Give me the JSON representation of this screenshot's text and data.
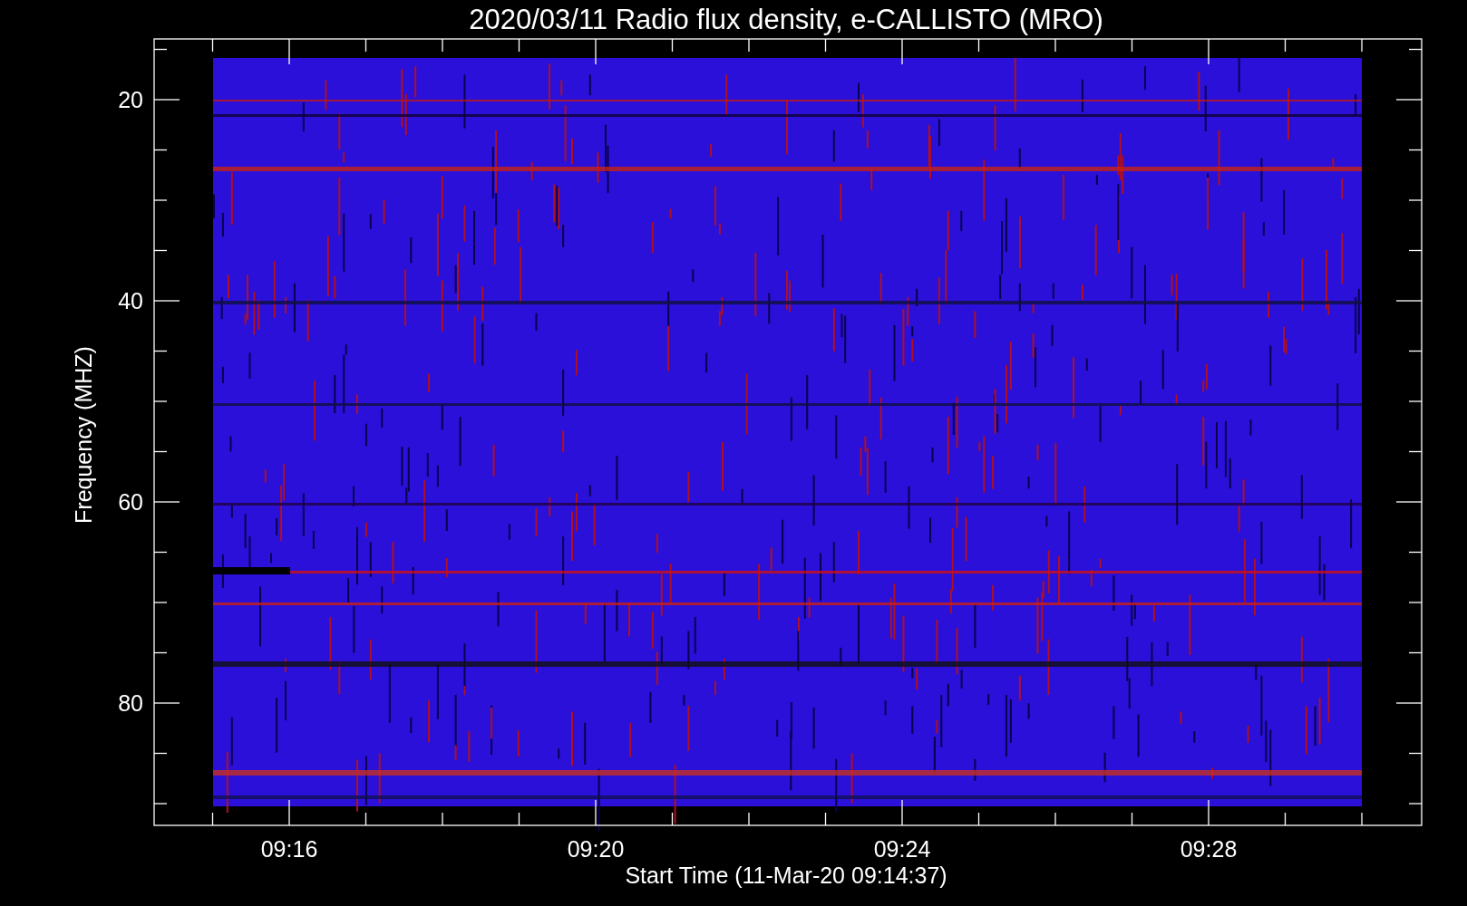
{
  "title": "2020/03/11  Radio flux density, e-CALLISTO (MRO)",
  "ylabel": "Frequency (MHZ)",
  "xlabel": "Start Time (11-Mar-20 09:14:37)",
  "yticks": [
    "20",
    "40",
    "60",
    "80"
  ],
  "xticks": [
    "09:16",
    "09:20",
    "09:24",
    "09:28"
  ]
}
